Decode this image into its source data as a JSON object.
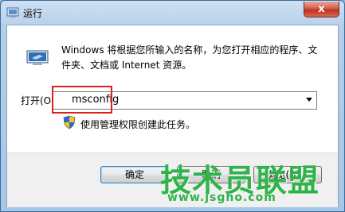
{
  "window": {
    "title": "运行",
    "close_glyph": "x"
  },
  "dialog": {
    "description": "Windows 将根据您所输入的名称，为您打开相应的程序、文件夹、文档或 Internet 资源。",
    "open_label": "打开(O):",
    "open_value": "msconfig",
    "admin_note": "使用管理权限创建此任务。"
  },
  "buttons": {
    "ok": "确定",
    "cancel": "取消",
    "browse": "浏览(B)..."
  },
  "watermark": {
    "brand": "技术员联盟",
    "url": "www.jsgho.com"
  },
  "icons": {
    "title": "run-icon",
    "program": "run-icon",
    "shield": "uac-shield-icon",
    "close": "close-icon",
    "dropdown": "chevron-down-icon"
  },
  "colors": {
    "highlight_border": "#e0201d",
    "watermark": "#2fb34a",
    "close_button": "#c0301e"
  }
}
